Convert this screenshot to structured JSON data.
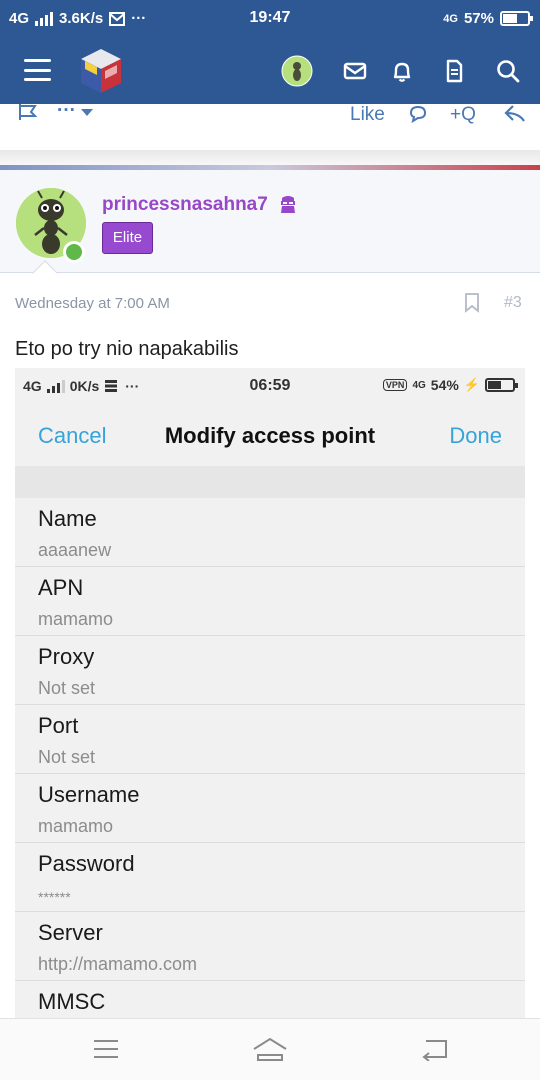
{
  "status_bar": {
    "network": "4G",
    "speed": "3.6K/s",
    "more": "···",
    "time": "19:47",
    "battery_network": "4G",
    "battery": "57%",
    "battery_level": 0.57
  },
  "app_bar": {
    "icons": [
      "menu-icon",
      "site-logo",
      "user-avatar",
      "mail-icon",
      "bell-icon",
      "document-icon",
      "search-icon"
    ]
  },
  "post_actions": {
    "more": "···",
    "like": "Like",
    "quote": "+Q"
  },
  "post": {
    "username": "princessnasahna7",
    "badge": "Elite",
    "date": "Wednesday at 7:00 AM",
    "number": "#3",
    "message": "Eto po try nio napakabilis"
  },
  "embedded": {
    "status": {
      "network": "4G",
      "speed": "0K/s",
      "more": "···",
      "time": "06:59",
      "vpn": "VPN",
      "battery_network": "4G",
      "battery": "54%",
      "battery_level": 0.54
    },
    "header": {
      "cancel": "Cancel",
      "title": "Modify access point",
      "done": "Done"
    },
    "fields": [
      {
        "label": "Name",
        "value": "aaaanew"
      },
      {
        "label": "APN",
        "value": "mamamo"
      },
      {
        "label": "Proxy",
        "value": "Not set"
      },
      {
        "label": "Port",
        "value": "Not set"
      },
      {
        "label": "Username",
        "value": "mamamo"
      },
      {
        "label": "Password",
        "value": "******"
      },
      {
        "label": "Server",
        "value": "http://mamamo.com"
      },
      {
        "label": "MMSC",
        "value": ""
      }
    ]
  },
  "nav_bar": {
    "icons": [
      "menu-icon",
      "home-icon",
      "back-icon"
    ]
  }
}
